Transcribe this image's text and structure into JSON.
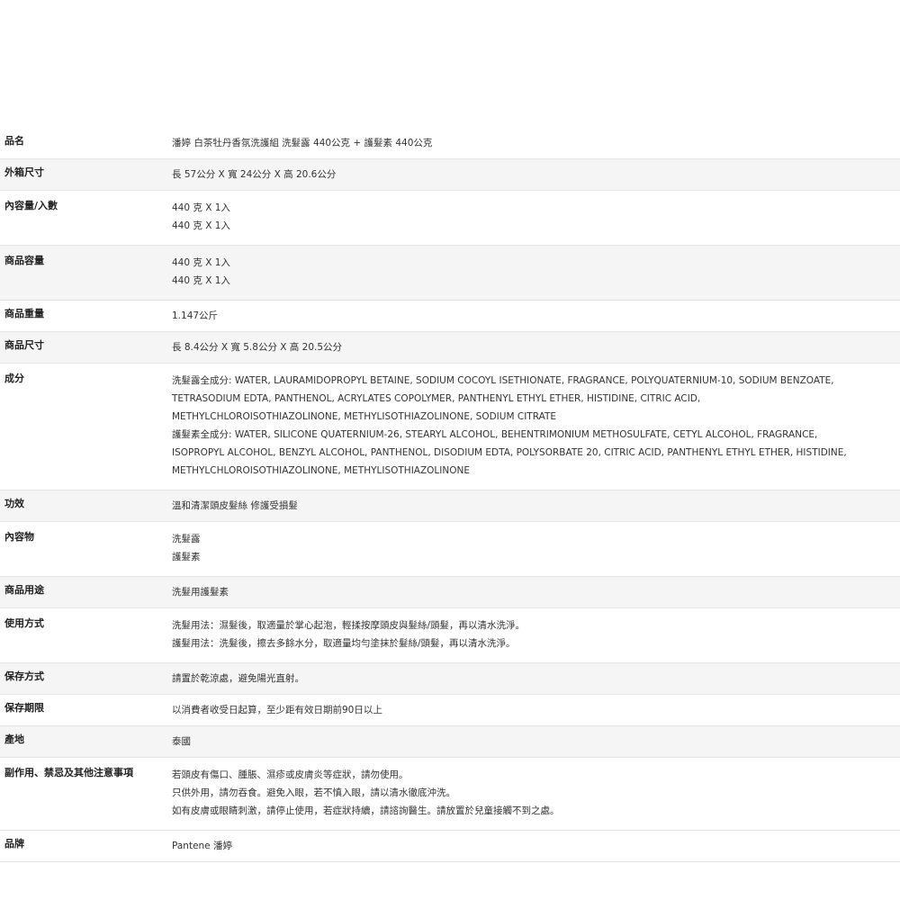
{
  "rows": [
    {
      "label": "品名",
      "lines": [
        "潘婷 白茶牡丹香氛洗護組 洗髮露 440公克 + 護髮素 440公克"
      ]
    },
    {
      "label": "外箱尺寸",
      "lines": [
        "長 57公分 X 寬 24公分 X 高 20.6公分"
      ]
    },
    {
      "label": "內容量/入數",
      "lines": [
        "440 克 X 1入",
        "440 克 X 1入"
      ]
    },
    {
      "label": "商品容量",
      "lines": [
        "440 克 X 1入",
        "440 克 X 1入"
      ]
    },
    {
      "label": "商品重量",
      "lines": [
        "1.147公斤"
      ]
    },
    {
      "label": "商品尺寸",
      "lines": [
        "長 8.4公分 X 寬 5.8公分 X 高 20.5公分"
      ]
    },
    {
      "label": "成分",
      "lines": [
        "洗髮露全成分: WATER, LAURAMIDOPROPYL BETAINE, SODIUM COCOYL ISETHIONATE, FRAGRANCE, POLYQUATERNIUM-10, SODIUM BENZOATE,",
        "TETRASODIUM EDTA, PANTHENOL, ACRYLATES COPOLYMER, PANTHENYL ETHYL ETHER, HISTIDINE, CITRIC ACID,",
        "METHYLCHLOROISOTHIAZOLINONE, METHYLISOTHIAZOLINONE, SODIUM CITRATE",
        "護髮素全成分: WATER, SILICONE QUATERNIUM-26, STEARYL ALCOHOL, BEHENTRIMONIUM METHOSULFATE, CETYL ALCOHOL, FRAGRANCE,",
        "ISOPROPYL ALCOHOL, BENZYL ALCOHOL, PANTHENOL, DISODIUM EDTA, POLYSORBATE 20, CITRIC ACID, PANTHENYL ETHYL ETHER, HISTIDINE,",
        "METHYLCHLOROISOTHIAZOLINONE, METHYLISOTHIAZOLINONE"
      ]
    },
    {
      "label": "功效",
      "lines": [
        "溫和清潔頭皮髮絲 修護受損髮"
      ]
    },
    {
      "label": "內容物",
      "lines": [
        "洗髮露",
        "護髮素"
      ]
    },
    {
      "label": "商品用途",
      "lines": [
        "洗髮用護髮素"
      ]
    },
    {
      "label": "使用方式",
      "lines": [
        "洗髮用法：濕髮後，取適量於掌心起泡，輕揉按摩頭皮與髮絲/頭髮，再以清水洗淨。",
        "護髮用法：洗髮後，擦去多餘水分，取適量均勻塗抹於髮絲/頭髮，再以清水洗淨。"
      ]
    },
    {
      "label": "保存方式",
      "lines": [
        "請置於乾涼處，避免陽光直射。"
      ]
    },
    {
      "label": "保存期限",
      "lines": [
        "以消費者收受日起算，至少距有效日期前90日以上"
      ]
    },
    {
      "label": "產地",
      "lines": [
        "泰國"
      ]
    },
    {
      "label": "副作用、禁忌及其他注意事項",
      "lines": [
        "若頭皮有傷口、腫脹、濕疹或皮膚炎等症狀，請勿使用。",
        "只供外用，請勿吞食。避免入眼，若不慎入眼，請以清水徹底沖洗。",
        "如有皮膚或眼睛刺激，請停止使用，若症狀持續，請諮詢醫生。請放置於兒童接觸不到之處。"
      ]
    },
    {
      "label": "品牌",
      "lines": [
        "Pantene 潘婷"
      ]
    }
  ]
}
